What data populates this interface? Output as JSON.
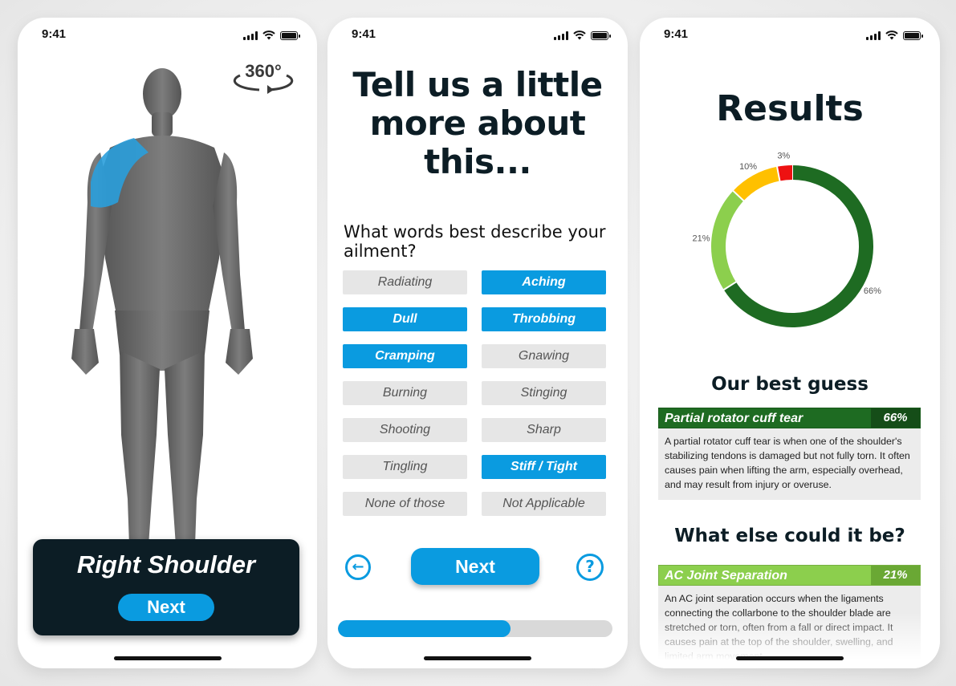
{
  "status_time": "9:41",
  "screen1": {
    "location_label": "Right Shoulder",
    "next_label": "Next",
    "rotate_badge": "360°"
  },
  "screen2": {
    "title": "Tell us a little more about this...",
    "question": "What words best describe your ailment?",
    "options": [
      {
        "label": "Radiating",
        "selected": false
      },
      {
        "label": "Aching",
        "selected": true
      },
      {
        "label": "Dull",
        "selected": true
      },
      {
        "label": "Throbbing",
        "selected": true
      },
      {
        "label": "Cramping",
        "selected": true
      },
      {
        "label": "Gnawing",
        "selected": false
      },
      {
        "label": "Burning",
        "selected": false
      },
      {
        "label": "Stinging",
        "selected": false
      },
      {
        "label": "Shooting",
        "selected": false
      },
      {
        "label": "Sharp",
        "selected": false
      },
      {
        "label": "Tingling",
        "selected": false
      },
      {
        "label": "Stiff / Tight",
        "selected": true
      },
      {
        "label": "None of those",
        "selected": false
      },
      {
        "label": "Not Applicable",
        "selected": false
      }
    ],
    "next_label": "Next",
    "back_icon": "arrow-left-circle-icon",
    "help_icon": "question-circle-icon",
    "progress": 0.63
  },
  "screen3": {
    "title": "Results",
    "chart_data": {
      "type": "pie",
      "style": "donut",
      "slices": [
        {
          "value": 66,
          "label": "66%",
          "color": "#1e6b22"
        },
        {
          "value": 21,
          "label": "21%",
          "color": "#8ccf4d"
        },
        {
          "value": 10,
          "label": "10%",
          "color": "#ffc000"
        },
        {
          "value": 3,
          "label": "3%",
          "color": "#ee1111"
        }
      ]
    },
    "best_guess_heading": "Our best guess",
    "best_guess": {
      "name": "Partial rotator cuff tear",
      "percent": "66%",
      "color": "#1e6b22",
      "pct_color": "#154d18",
      "description": "A partial rotator cuff tear is when one of the shoulder's stabilizing tendons is damaged but not fully torn. It often causes pain when lifting the arm, especially overhead, and may result from injury or overuse."
    },
    "else_heading": "What else could it be?",
    "alternative": {
      "name": "AC Joint Separation",
      "percent": "21%",
      "color": "#8ccf4d",
      "pct_color": "#6aa834",
      "description": "An AC joint separation occurs when the ligaments connecting the collarbone to the shoulder blade are stretched or torn, often from a fall or direct impact. It causes pain at the top of the shoulder, swelling, and limited arm movement."
    }
  },
  "colors": {
    "accent": "#0a9be0",
    "dark": "#0c1d25",
    "chip_bg": "#e6e6e6"
  }
}
